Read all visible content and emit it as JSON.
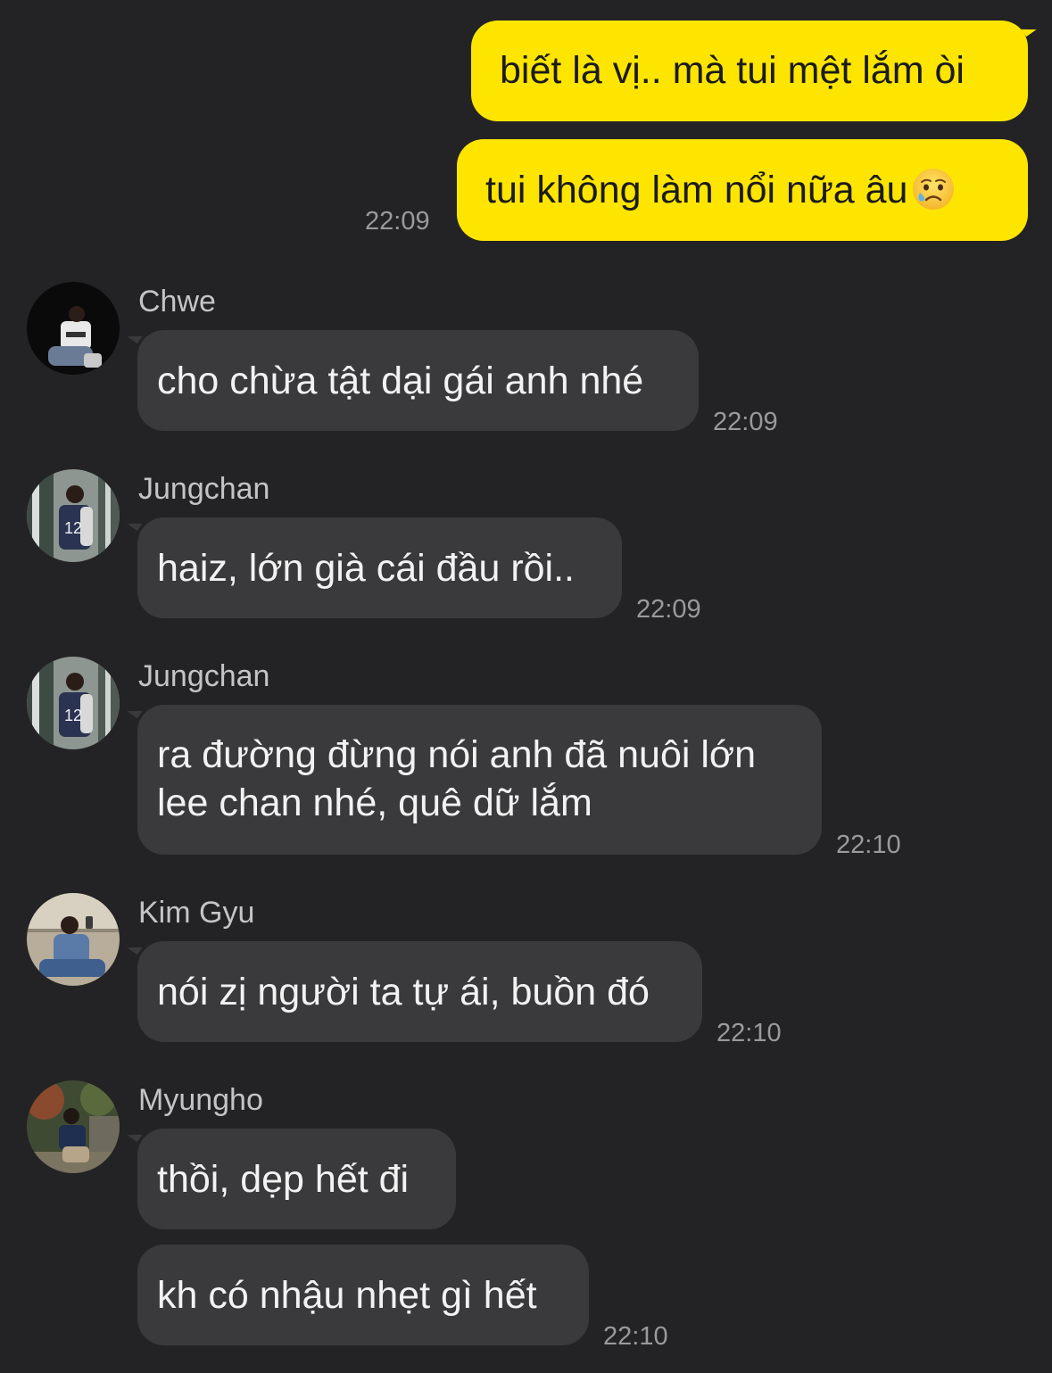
{
  "messages": [
    {
      "text": "biết là vị.. mà tui mệt lắm òi"
    },
    {
      "text": "tui không làm nổi nữa âu",
      "emoji": "crying-face-emoji",
      "time": "22:09"
    },
    {
      "sender": "Chwe",
      "text": "cho chừa tật dại gái anh nhé",
      "time": "22:09"
    },
    {
      "sender": "Jungchan",
      "text": "haiz, lớn già cái đầu rồi..",
      "time": "22:09"
    },
    {
      "sender": "Jungchan",
      "text": "ra đường đừng nói anh đã nuôi lớn lee chan nhé, quê dữ lắm",
      "time": "22:10"
    },
    {
      "sender": "Kim Gyu",
      "text": "nói zị người ta tự ái, buồn đó",
      "time": "22:10"
    },
    {
      "sender": "Myungho",
      "text": "thồi, dẹp hết đi"
    },
    {
      "text": "kh có nhậu nhẹt gì hết",
      "time": "22:10"
    }
  ],
  "colors": {
    "background": "#232325",
    "outgoing_bubble": "#FEE500",
    "incoming_bubble": "#3a3a3c",
    "timestamp": "#9a9a9c"
  }
}
